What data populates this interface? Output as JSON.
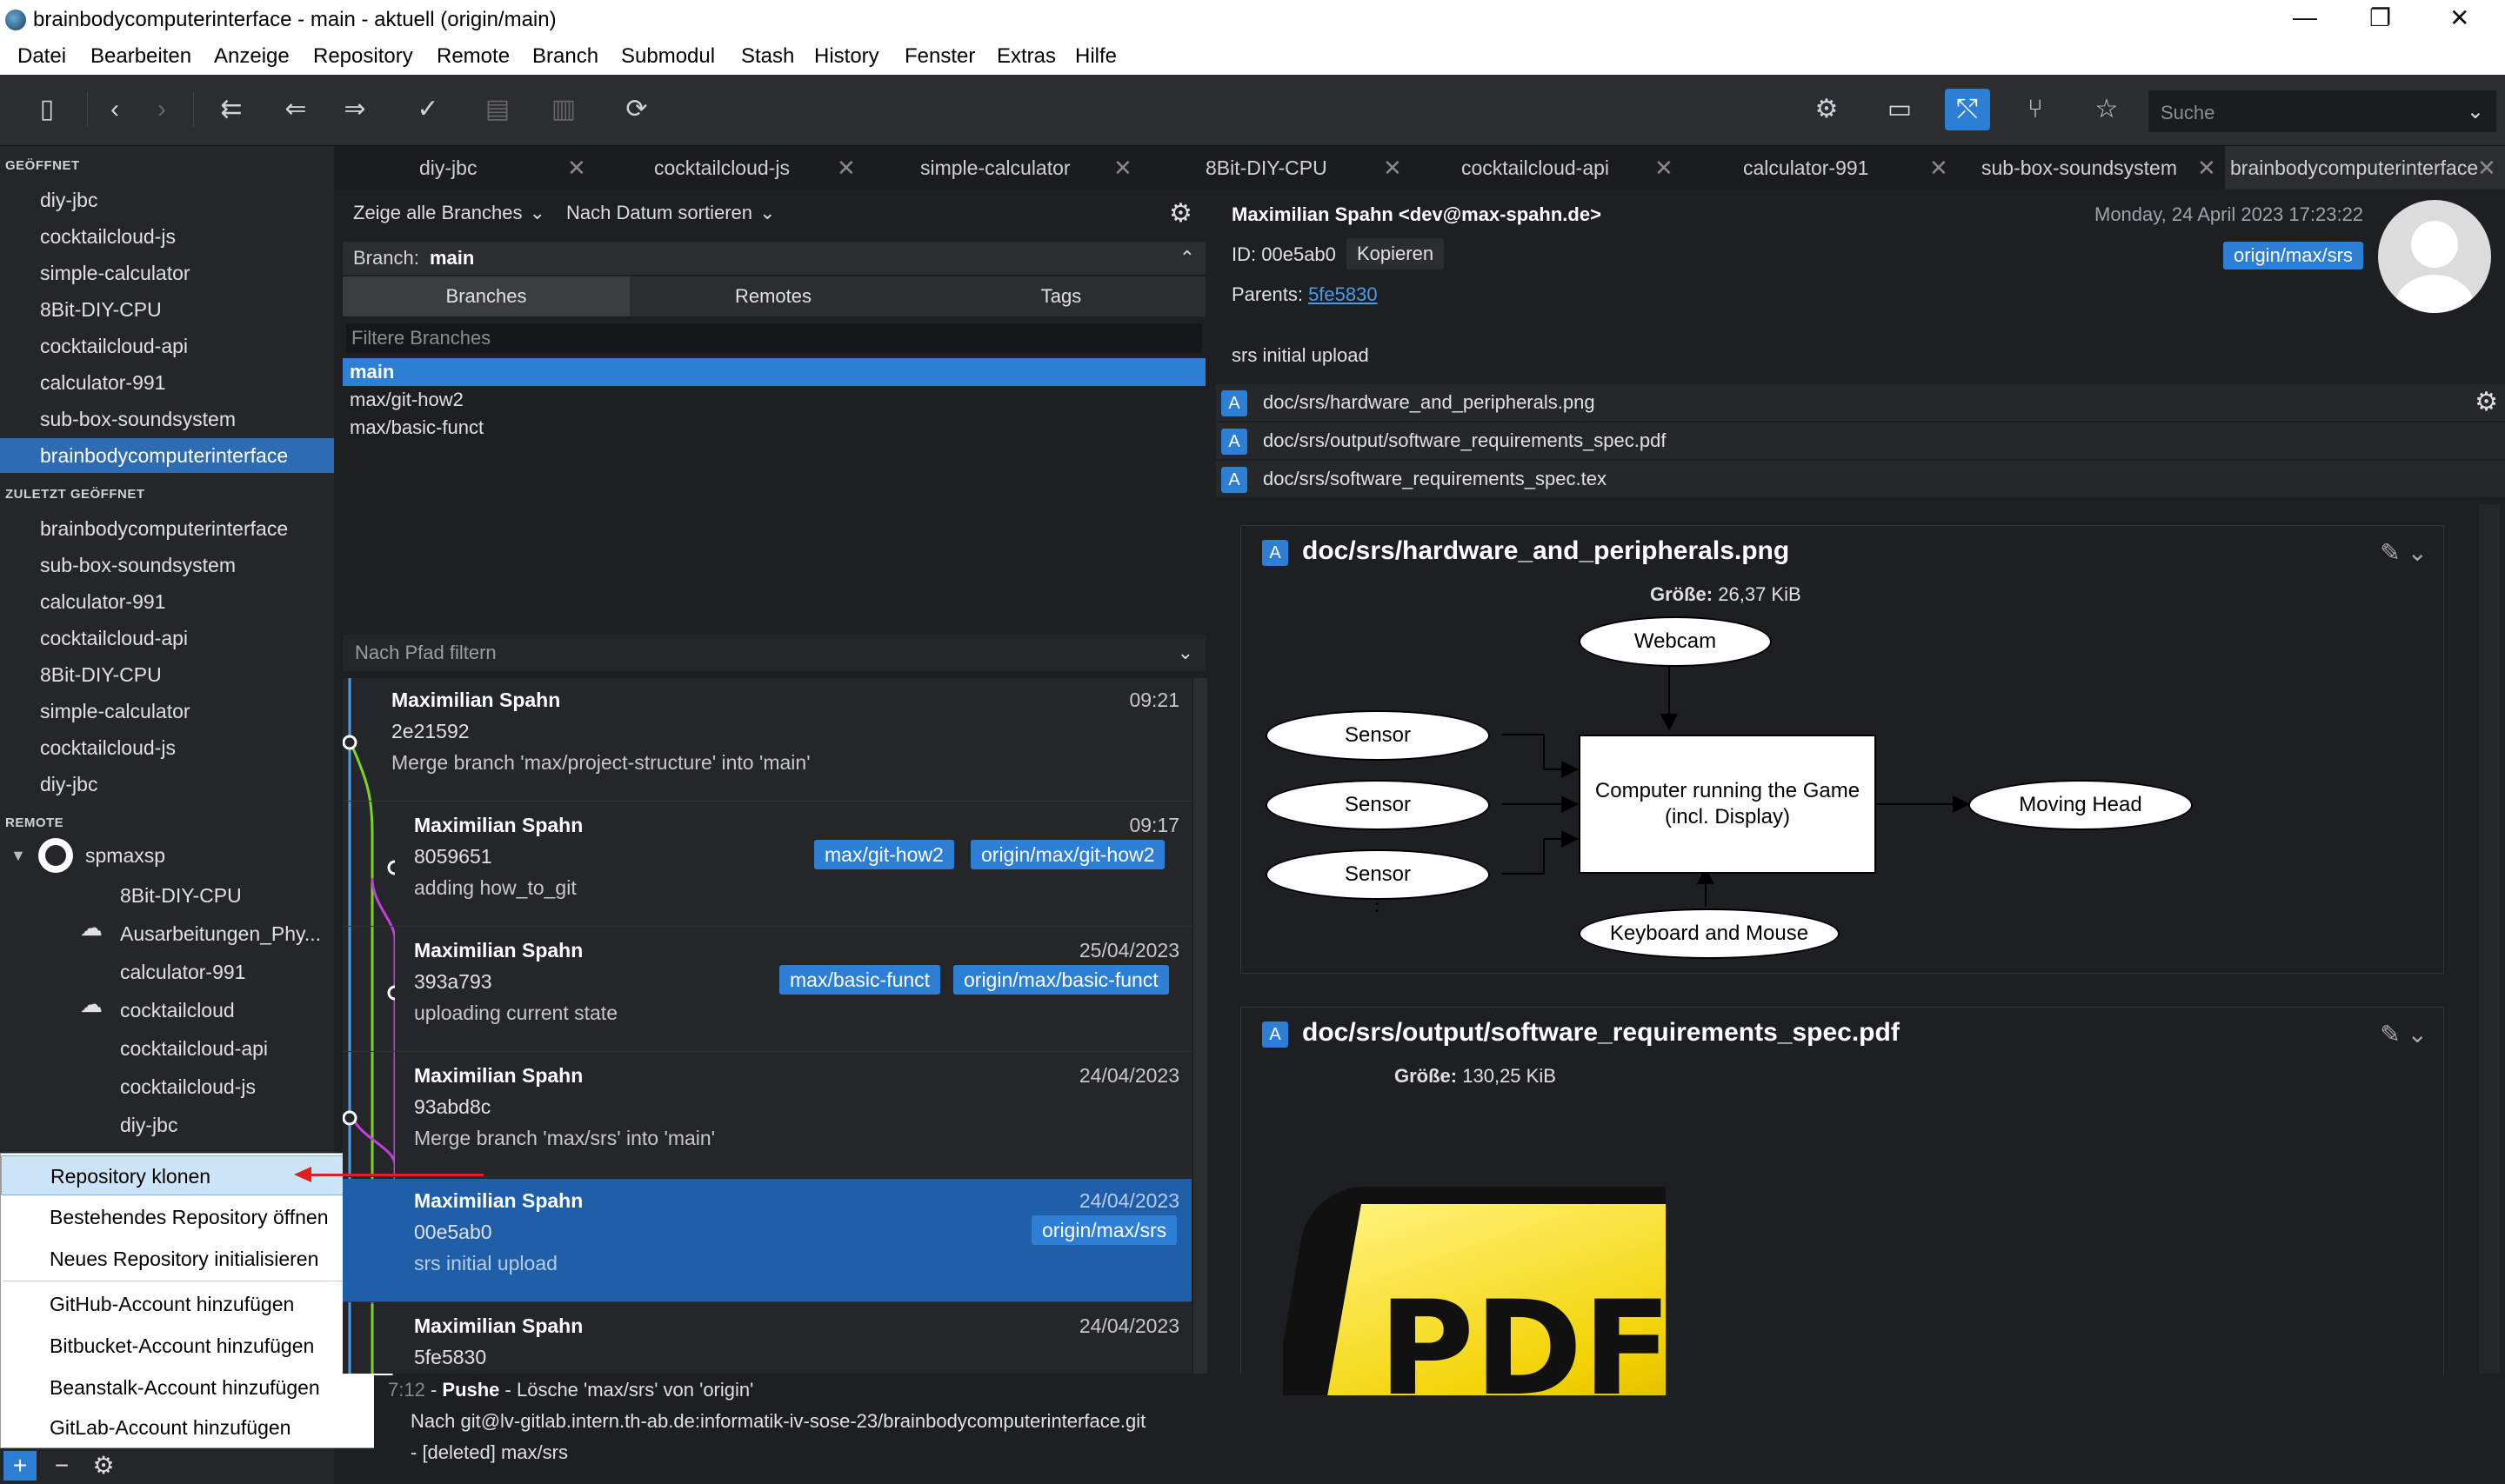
{
  "window": {
    "title": "brainbodycomputerinterface - main - aktuell (origin/main)",
    "minimize": "—",
    "maximize": "❐",
    "close": "✕"
  },
  "menu": [
    "Datei",
    "Bearbeiten",
    "Anzeige",
    "Repository",
    "Remote",
    "Branch",
    "Submodul",
    "Stash",
    "History",
    "Fenster",
    "Extras",
    "Hilfe"
  ],
  "search": {
    "placeholder": "Suche"
  },
  "sidebar": {
    "opened_title": "GEÖFFNET",
    "opened": [
      "diy-jbc",
      "cocktailcloud-js",
      "simple-calculator",
      "8Bit-DIY-CPU",
      "cocktailcloud-api",
      "calculator-991",
      "sub-box-soundsystem",
      "brainbodycomputerinterface"
    ],
    "recent_title": "ZULETZT GEÖFFNET",
    "recent": [
      "brainbodycomputerinterface",
      "sub-box-soundsystem",
      "calculator-991",
      "cocktailcloud-api",
      "8Bit-DIY-CPU",
      "simple-calculator",
      "cocktailcloud-js",
      "diy-jbc"
    ],
    "remote_title": "REMOTE",
    "remote_account": "spmaxsp",
    "remote_repos": [
      "8Bit-DIY-CPU",
      "Ausarbeitungen_Phy...",
      "calculator-991",
      "cocktailcloud",
      "cocktailcloud-api",
      "cocktailcloud-js",
      "diy-jbc"
    ]
  },
  "context_menu": [
    "Repository klonen",
    "Bestehendes Repository öffnen",
    "Neues Repository initialisieren",
    "GitHub-Account hinzufügen",
    "Bitbucket-Account hinzufügen",
    "Beanstalk-Account hinzufügen",
    "GitLab-Account hinzufügen"
  ],
  "tabs": [
    "diy-jbc",
    "cocktailcloud-js",
    "simple-calculator",
    "8Bit-DIY-CPU",
    "cocktailcloud-api",
    "calculator-991",
    "sub-box-soundsystem",
    "brainbodycomputerinterface"
  ],
  "branches": {
    "show_all": "Zeige alle Branches",
    "sort": "Nach Datum sortieren",
    "current_label": "Branch:",
    "current": "main",
    "tab_branches": "Branches",
    "tab_remotes": "Remotes",
    "tab_tags": "Tags",
    "filter_placeholder": "Filtere Branches",
    "list": [
      "main",
      "max/git-how2",
      "max/basic-funct"
    ]
  },
  "path_filter": "Nach Pfad filtern",
  "commits": [
    {
      "author": "Maximilian Spahn",
      "hash": "2e21592",
      "msg": "Merge branch 'max/project-structure' into 'main'",
      "date": "09:21",
      "badges": []
    },
    {
      "author": "Maximilian Spahn",
      "hash": "8059651",
      "msg": "adding how_to_git",
      "date": "09:17",
      "badges": [
        "max/git-how2",
        "origin/max/git-how2"
      ]
    },
    {
      "author": "Maximilian Spahn",
      "hash": "393a793",
      "msg": "uploading current state",
      "date": "25/04/2023",
      "badges": [
        "max/basic-funct",
        "origin/max/basic-funct"
      ]
    },
    {
      "author": "Maximilian Spahn",
      "hash": "93abd8c",
      "msg": "Merge branch 'max/srs' into 'main'",
      "date": "24/04/2023",
      "badges": []
    },
    {
      "author": "Maximilian Spahn",
      "hash": "00e5ab0",
      "msg": "srs initial upload",
      "date": "24/04/2023",
      "badges": [
        "origin/max/srs"
      ]
    },
    {
      "author": "Maximilian Spahn",
      "hash": "5fe5830",
      "msg": "",
      "date": "24/04/2023",
      "badges": []
    }
  ],
  "log": {
    "line1_time": "7:12",
    "line1_action": "Pushe",
    "line1_rest": " - Lösche 'max/srs' von 'origin'",
    "line2": "Nach git@lv-gitlab.intern.th-ab.de:informatik-iv-sose-23/brainbodycomputerinterface.git",
    "line3": "- [deleted] max/srs"
  },
  "detail": {
    "author": "Maximilian Spahn <dev@max-spahn.de>",
    "date": "Monday, 24 April 2023 17:23:22",
    "id_label": "ID:",
    "id": "00e5ab0",
    "copy": "Kopieren",
    "parents_label": "Parents:",
    "parent": "5fe5830",
    "badge": "origin/max/srs",
    "message": "srs initial upload",
    "files": [
      "doc/srs/hardware_and_peripherals.png",
      "doc/srs/output/software_requirements_spec.pdf",
      "doc/srs/software_requirements_spec.tex"
    ],
    "file_status": "A",
    "card1_title": "doc/srs/hardware_and_peripherals.png",
    "card1_size_label": "Größe:",
    "card1_size": "26,37 KiB",
    "card2_title": "doc/srs/output/software_requirements_spec.pdf",
    "card2_size_label": "Größe:",
    "card2_size": "130,25 KiB"
  },
  "diagram": {
    "webcam": "Webcam",
    "sensor": "Sensor",
    "computer_line1": "Computer running the Game",
    "computer_line2": "(incl. Display)",
    "moving_head": "Moving Head",
    "keyboard": "Keyboard and Mouse"
  },
  "pdf_icon_text": "PDF",
  "colors": {
    "accent": "#2d7fd6",
    "selection": "#2d6bb3",
    "graph_main": "#4a9be8",
    "graph_green": "#7ed321",
    "graph_purple": "#c040e0"
  }
}
